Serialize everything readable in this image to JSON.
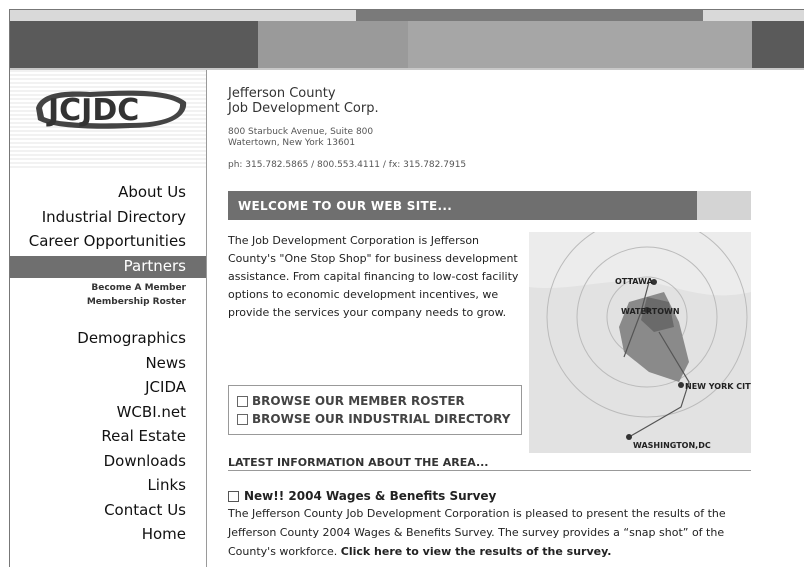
{
  "logo": {
    "text": "JCJDC"
  },
  "org": {
    "name_line1": "Jefferson County",
    "name_line2": "Job Development Corp.",
    "address_line1": "800 Starbuck Avenue, Suite 800",
    "address_line2": "Watertown, New York 13601",
    "phone": "ph: 315.782.5865 / 800.553.4111 / fx: 315.782.7915"
  },
  "nav": {
    "items_top": [
      "About Us",
      "Industrial Directory",
      "Career Opportunities"
    ],
    "active": "Partners",
    "sub_items": [
      "Become A Member",
      "Membership Roster"
    ],
    "items_bottom": [
      "Demographics",
      "News",
      "JCIDA",
      "WCBI.net",
      "Real Estate",
      "Downloads",
      "Links",
      "Contact Us",
      "Home"
    ]
  },
  "welcome": {
    "title": "WELCOME TO OUR WEB SITE..."
  },
  "intro": {
    "text": "The Job Development Corporation is Jefferson County's \"One Stop Shop\" for business development assistance. From capital financing to low-cost facility options to economic development incentives, we provide the services your company needs to grow."
  },
  "map": {
    "labels": {
      "ottawa": "OTTAWA",
      "watertown": "WATERTOWN",
      "nyc": "NEW YORK CITY",
      "dc": "WASHINGTON,DC"
    }
  },
  "browse": {
    "roster": "BROWSE OUR MEMBER ROSTER",
    "directory": "BROWSE OUR INDUSTRIAL DIRECTORY"
  },
  "latest": {
    "title": "LATEST INFORMATION ABOUT THE AREA..."
  },
  "news": {
    "title": "New!! 2004 Wages & Benefits Survey",
    "body": "The Jefferson County Job Development Corporation is pleased to present the results of the Jefferson County 2004 Wages & Benefits Survey. The survey provides a “snap shot” of the County's workforce.",
    "link": "Click here to view the results of the survey."
  },
  "colors": {
    "active_nav": "#6f6f6f",
    "header_dark": "#5a5a5a",
    "header_mid": "#9a9a9a"
  }
}
